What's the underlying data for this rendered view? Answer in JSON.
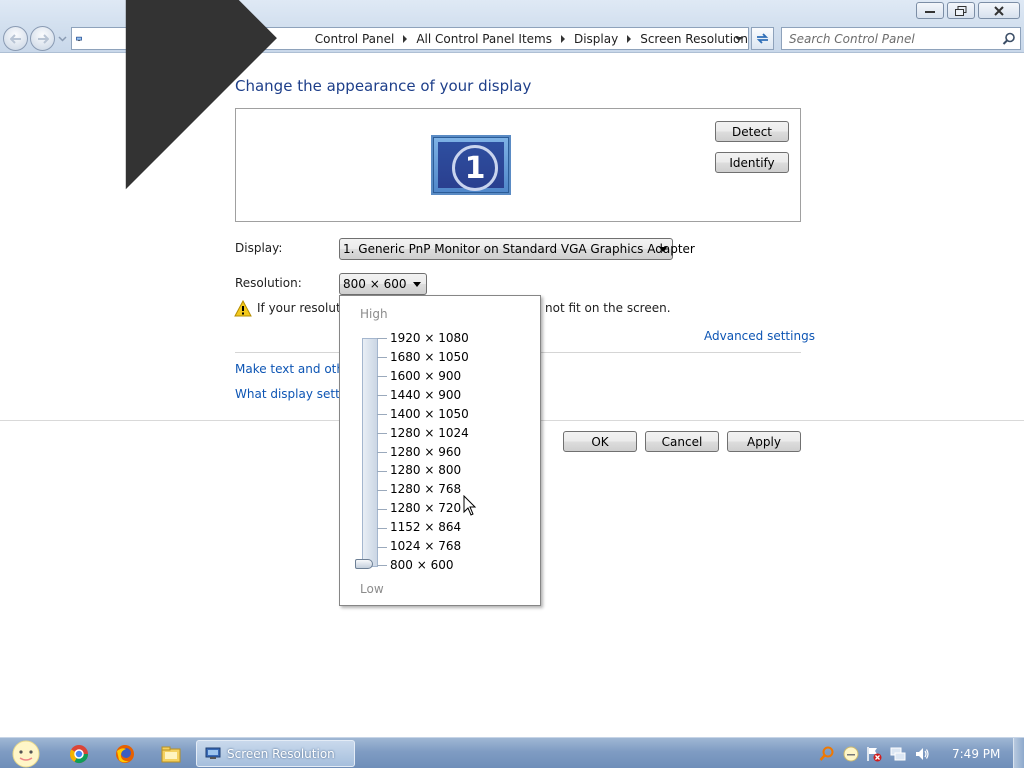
{
  "window": {
    "title_buttons": [
      "minimize-icon",
      "restore-icon",
      "close-icon"
    ]
  },
  "address_bar": {
    "breadcrumbs": [
      "Control Panel",
      "All Control Panel Items",
      "Display",
      "Screen Resolution"
    ],
    "search_placeholder": "Search Control Panel"
  },
  "page": {
    "heading": "Change the appearance of your display",
    "detect_label": "Detect",
    "identify_label": "Identify",
    "monitor_number": "1",
    "display_label": "Display:",
    "display_value": "1. Generic PnP Monitor on Standard VGA Graphics Adapter",
    "resolution_label": "Resolution:",
    "resolution_value": "800 × 600",
    "warning_text_start": "If your resolutio",
    "warning_text_end": "not fit on the screen.",
    "advanced_settings": "Advanced settings",
    "link_text_size": "Make text and other",
    "link_what_settings": "What display setting",
    "ok_label": "OK",
    "cancel_label": "Cancel",
    "apply_label": "Apply"
  },
  "resolution_dropdown": {
    "high_label": "High",
    "low_label": "Low",
    "options": [
      "1920 × 1080",
      "1680 × 1050",
      "1600 × 900",
      "1440 × 900",
      "1400 × 1050",
      "1280 × 1024",
      "1280 × 960",
      "1280 × 800",
      "1280 × 768",
      "1280 × 720",
      "1152 × 864",
      "1024 × 768",
      "800 × 600"
    ],
    "selected": "800 × 600"
  },
  "taskbar": {
    "task_label": "Screen Resolution",
    "clock": "7:49 PM"
  }
}
